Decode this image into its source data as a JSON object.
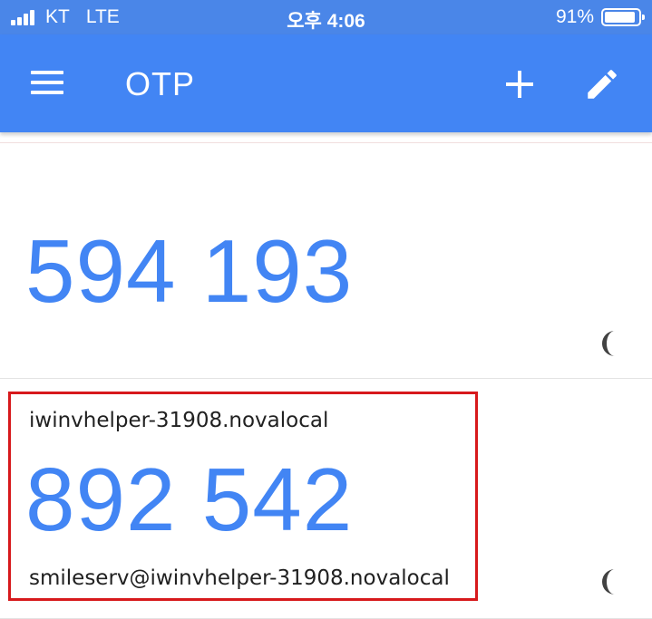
{
  "status_bar": {
    "carrier": "KT",
    "network": "LTE",
    "time": "오후 4:06",
    "battery": "91%",
    "battery_level": 0.91
  },
  "app_bar": {
    "title": "OTP",
    "icons": [
      "menu-icon",
      "add-icon",
      "edit-icon"
    ]
  },
  "accounts": [
    {
      "issuer": "",
      "code": "594 193",
      "account": "",
      "timer_icon": "countdown-timer-icon"
    },
    {
      "issuer": "iwinvhelper-31908.novalocal",
      "code": "892 542",
      "account": "smileserv@iwinvhelper-31908.novalocal",
      "timer_icon": "countdown-timer-icon"
    }
  ],
  "colors": {
    "status_bar": "#4a86e8",
    "app_bar": "#4285f4",
    "code_text": "#4285f4",
    "highlight": "#d7191c",
    "timer": "#424242"
  }
}
